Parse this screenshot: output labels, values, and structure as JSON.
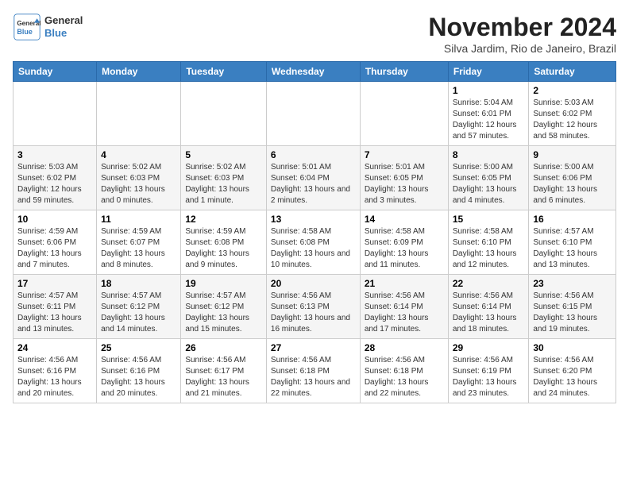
{
  "header": {
    "logo_line1": "General",
    "logo_line2": "Blue",
    "month_year": "November 2024",
    "location": "Silva Jardim, Rio de Janeiro, Brazil"
  },
  "weekdays": [
    "Sunday",
    "Monday",
    "Tuesday",
    "Wednesday",
    "Thursday",
    "Friday",
    "Saturday"
  ],
  "weeks": [
    [
      {
        "day": "",
        "info": ""
      },
      {
        "day": "",
        "info": ""
      },
      {
        "day": "",
        "info": ""
      },
      {
        "day": "",
        "info": ""
      },
      {
        "day": "",
        "info": ""
      },
      {
        "day": "1",
        "info": "Sunrise: 5:04 AM\nSunset: 6:01 PM\nDaylight: 12 hours and 57 minutes."
      },
      {
        "day": "2",
        "info": "Sunrise: 5:03 AM\nSunset: 6:02 PM\nDaylight: 12 hours and 58 minutes."
      }
    ],
    [
      {
        "day": "3",
        "info": "Sunrise: 5:03 AM\nSunset: 6:02 PM\nDaylight: 12 hours and 59 minutes."
      },
      {
        "day": "4",
        "info": "Sunrise: 5:02 AM\nSunset: 6:03 PM\nDaylight: 13 hours and 0 minutes."
      },
      {
        "day": "5",
        "info": "Sunrise: 5:02 AM\nSunset: 6:03 PM\nDaylight: 13 hours and 1 minute."
      },
      {
        "day": "6",
        "info": "Sunrise: 5:01 AM\nSunset: 6:04 PM\nDaylight: 13 hours and 2 minutes."
      },
      {
        "day": "7",
        "info": "Sunrise: 5:01 AM\nSunset: 6:05 PM\nDaylight: 13 hours and 3 minutes."
      },
      {
        "day": "8",
        "info": "Sunrise: 5:00 AM\nSunset: 6:05 PM\nDaylight: 13 hours and 4 minutes."
      },
      {
        "day": "9",
        "info": "Sunrise: 5:00 AM\nSunset: 6:06 PM\nDaylight: 13 hours and 6 minutes."
      }
    ],
    [
      {
        "day": "10",
        "info": "Sunrise: 4:59 AM\nSunset: 6:06 PM\nDaylight: 13 hours and 7 minutes."
      },
      {
        "day": "11",
        "info": "Sunrise: 4:59 AM\nSunset: 6:07 PM\nDaylight: 13 hours and 8 minutes."
      },
      {
        "day": "12",
        "info": "Sunrise: 4:59 AM\nSunset: 6:08 PM\nDaylight: 13 hours and 9 minutes."
      },
      {
        "day": "13",
        "info": "Sunrise: 4:58 AM\nSunset: 6:08 PM\nDaylight: 13 hours and 10 minutes."
      },
      {
        "day": "14",
        "info": "Sunrise: 4:58 AM\nSunset: 6:09 PM\nDaylight: 13 hours and 11 minutes."
      },
      {
        "day": "15",
        "info": "Sunrise: 4:58 AM\nSunset: 6:10 PM\nDaylight: 13 hours and 12 minutes."
      },
      {
        "day": "16",
        "info": "Sunrise: 4:57 AM\nSunset: 6:10 PM\nDaylight: 13 hours and 13 minutes."
      }
    ],
    [
      {
        "day": "17",
        "info": "Sunrise: 4:57 AM\nSunset: 6:11 PM\nDaylight: 13 hours and 13 minutes."
      },
      {
        "day": "18",
        "info": "Sunrise: 4:57 AM\nSunset: 6:12 PM\nDaylight: 13 hours and 14 minutes."
      },
      {
        "day": "19",
        "info": "Sunrise: 4:57 AM\nSunset: 6:12 PM\nDaylight: 13 hours and 15 minutes."
      },
      {
        "day": "20",
        "info": "Sunrise: 4:56 AM\nSunset: 6:13 PM\nDaylight: 13 hours and 16 minutes."
      },
      {
        "day": "21",
        "info": "Sunrise: 4:56 AM\nSunset: 6:14 PM\nDaylight: 13 hours and 17 minutes."
      },
      {
        "day": "22",
        "info": "Sunrise: 4:56 AM\nSunset: 6:14 PM\nDaylight: 13 hours and 18 minutes."
      },
      {
        "day": "23",
        "info": "Sunrise: 4:56 AM\nSunset: 6:15 PM\nDaylight: 13 hours and 19 minutes."
      }
    ],
    [
      {
        "day": "24",
        "info": "Sunrise: 4:56 AM\nSunset: 6:16 PM\nDaylight: 13 hours and 20 minutes."
      },
      {
        "day": "25",
        "info": "Sunrise: 4:56 AM\nSunset: 6:16 PM\nDaylight: 13 hours and 20 minutes."
      },
      {
        "day": "26",
        "info": "Sunrise: 4:56 AM\nSunset: 6:17 PM\nDaylight: 13 hours and 21 minutes."
      },
      {
        "day": "27",
        "info": "Sunrise: 4:56 AM\nSunset: 6:18 PM\nDaylight: 13 hours and 22 minutes."
      },
      {
        "day": "28",
        "info": "Sunrise: 4:56 AM\nSunset: 6:18 PM\nDaylight: 13 hours and 22 minutes."
      },
      {
        "day": "29",
        "info": "Sunrise: 4:56 AM\nSunset: 6:19 PM\nDaylight: 13 hours and 23 minutes."
      },
      {
        "day": "30",
        "info": "Sunrise: 4:56 AM\nSunset: 6:20 PM\nDaylight: 13 hours and 24 minutes."
      }
    ]
  ]
}
